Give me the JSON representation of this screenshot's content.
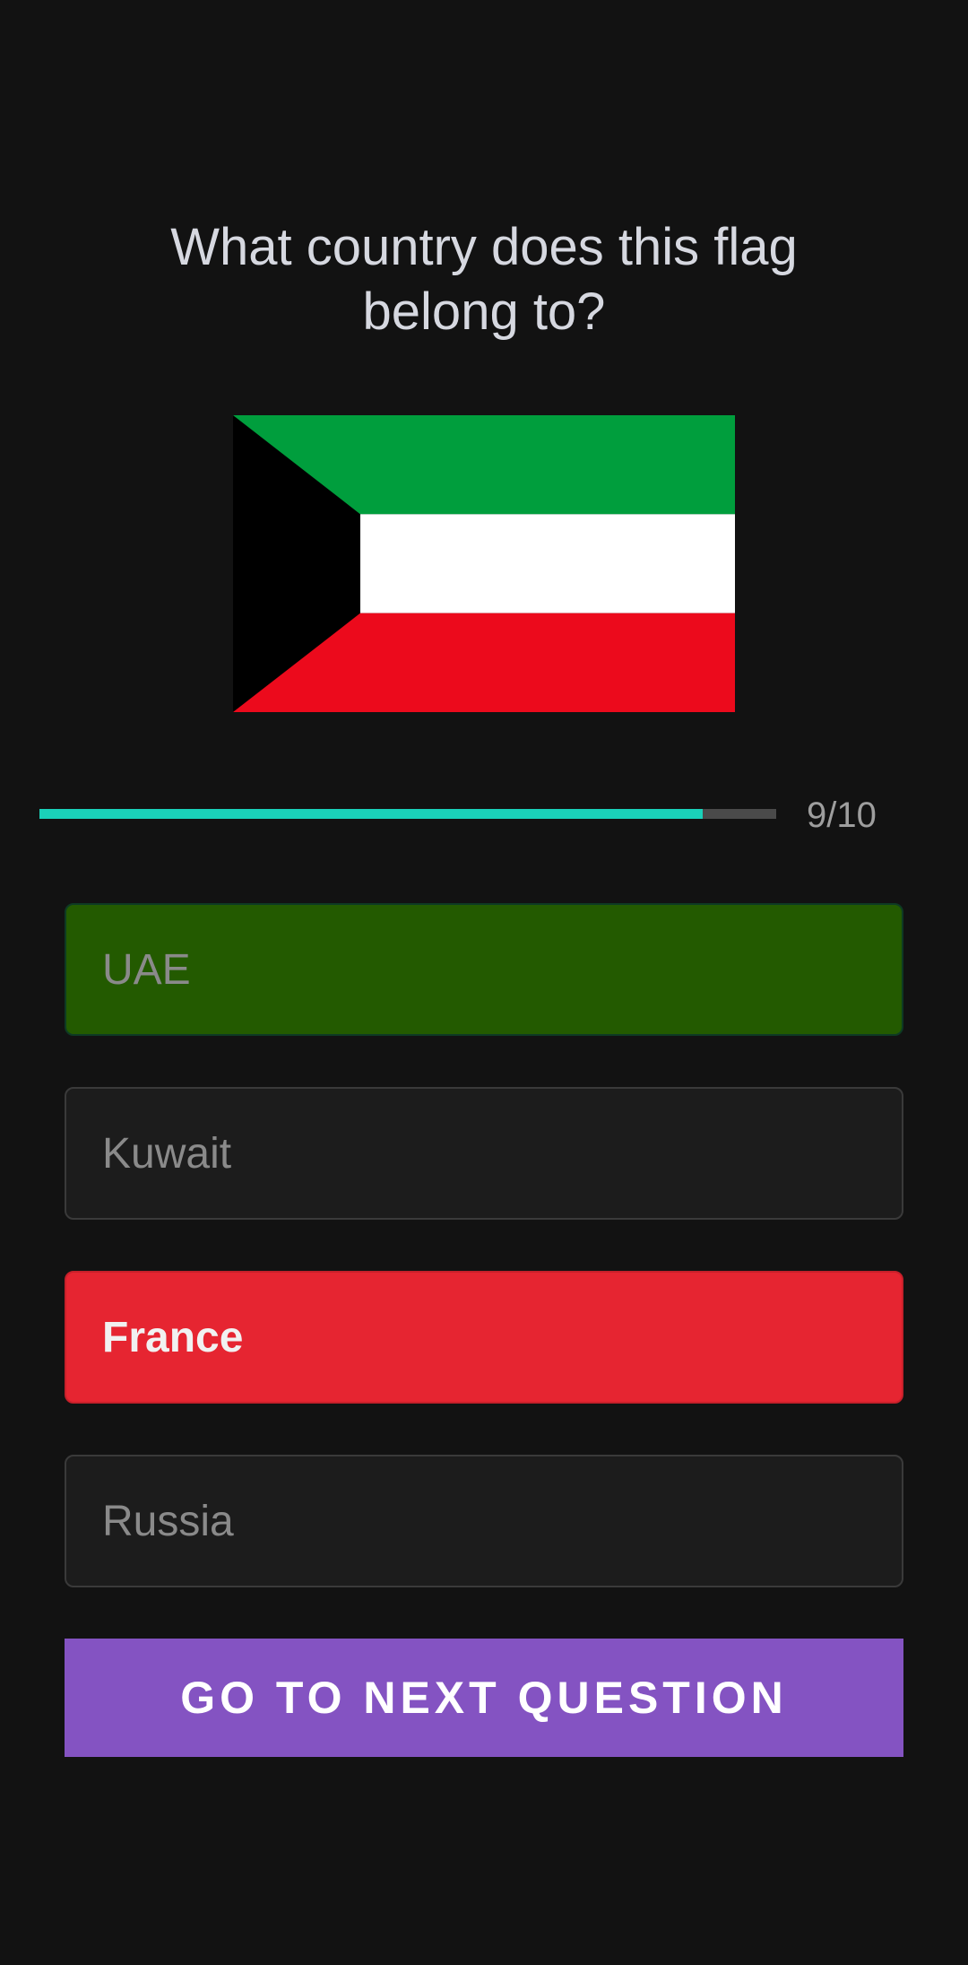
{
  "question": {
    "text": "What country does this flag belong to?"
  },
  "flag": {
    "name": "kuwait-flag",
    "colors": {
      "green": "#009e3d",
      "white": "#ffffff",
      "red": "#ec0a1c",
      "black": "#000000"
    }
  },
  "progress": {
    "current": 9,
    "total": 10,
    "fraction": 0.9,
    "label": "9/10",
    "fill_color": "#1ad1b9"
  },
  "options": [
    {
      "label": "UAE",
      "state": "correct",
      "color": "#235a00"
    },
    {
      "label": "Kuwait",
      "state": "default",
      "color": "#1c1c1c"
    },
    {
      "label": "France",
      "state": "wrong-selected",
      "color": "#e62531"
    },
    {
      "label": "Russia",
      "state": "default",
      "color": "#1c1c1c"
    }
  ],
  "next_button": {
    "label": "GO TO NEXT QUESTION",
    "color": "#8453c2"
  }
}
